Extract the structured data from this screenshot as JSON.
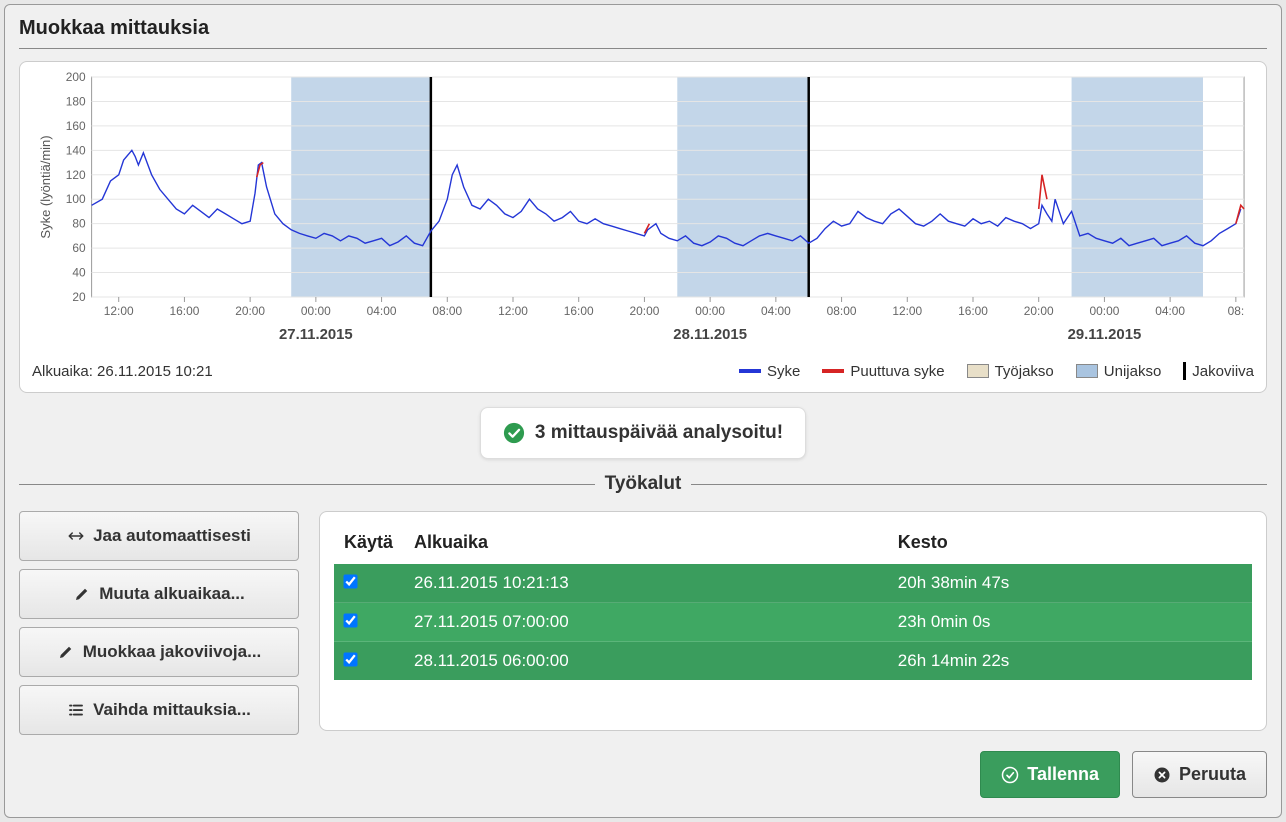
{
  "dialog_title": "Muokkaa mittauksia",
  "status_message": "3 mittauspäivää analysoitu!",
  "tools_heading": "Työkalut",
  "chart_start_label": "Alkuaika: 26.11.2015 10:21",
  "legend": {
    "syke": "Syke",
    "puuttuva": "Puuttuva syke",
    "tyojakso": "Työjakso",
    "unijakso": "Unijakso",
    "jakoviiva": "Jakoviiva"
  },
  "tool_buttons": {
    "auto_split": "Jaa automaattisesti",
    "change_start": "Muuta alkuaikaa...",
    "edit_dividers": "Muokkaa jakoviivoja...",
    "change_measurements": "Vaihda mittauksia..."
  },
  "table": {
    "headers": {
      "use": "Käytä",
      "start": "Alkuaika",
      "duration": "Kesto"
    },
    "rows": [
      {
        "checked": true,
        "start": "26.11.2015 10:21:13",
        "duration": "20h 38min 47s"
      },
      {
        "checked": true,
        "start": "27.11.2015 07:00:00",
        "duration": "23h 0min 0s"
      },
      {
        "checked": true,
        "start": "28.11.2015 06:00:00",
        "duration": "26h 14min 22s"
      }
    ]
  },
  "footer": {
    "save": "Tallenna",
    "cancel": "Peruuta"
  },
  "chart_data": {
    "type": "line",
    "title": "",
    "ylabel": "Syke (lyöntiä/min)",
    "xlabel": "",
    "ylim": [
      20,
      200
    ],
    "yticks": [
      20,
      40,
      60,
      80,
      100,
      120,
      140,
      160,
      180,
      200
    ],
    "x_start_hours": 10.35,
    "x_end_hours": 80.5,
    "xticks_hours": [
      12,
      16,
      20,
      24,
      28,
      32,
      36,
      40,
      44,
      48,
      52,
      56,
      60,
      64,
      68,
      72,
      76,
      80
    ],
    "xtick_labels": [
      "12:00",
      "16:00",
      "20:00",
      "00:00",
      "04:00",
      "08:00",
      "12:00",
      "16:00",
      "20:00",
      "00:00",
      "04:00",
      "08:00",
      "12:00",
      "16:00",
      "20:00",
      "00:00",
      "04:00",
      "08:"
    ],
    "date_labels": [
      {
        "hour": 24,
        "text": "27.11.2015"
      },
      {
        "hour": 48,
        "text": "28.11.2015"
      },
      {
        "hour": 72,
        "text": "29.11.2015"
      }
    ],
    "sleep_bands_hours": [
      {
        "start": 22.5,
        "end": 31
      },
      {
        "start": 46,
        "end": 54
      },
      {
        "start": 70,
        "end": 78
      }
    ],
    "divider_hours": [
      31,
      54
    ],
    "series": [
      {
        "name": "Syke",
        "color": "#2436d6",
        "x_hours": [
          10.35,
          11,
          11.5,
          12,
          12.3,
          12.8,
          13,
          13.2,
          13.5,
          14,
          14.5,
          15,
          15.5,
          16,
          16.5,
          17,
          17.5,
          18,
          18.5,
          19,
          19.5,
          20,
          20.3,
          20.5,
          20.7,
          21,
          21.5,
          22,
          22.5,
          23,
          23.5,
          24,
          24.5,
          25,
          25.5,
          26,
          26.5,
          27,
          27.5,
          28,
          28.5,
          29,
          29.5,
          30,
          30.5,
          31,
          31.5,
          32,
          32.3,
          32.6,
          33,
          33.5,
          34,
          34.5,
          35,
          35.5,
          36,
          36.5,
          37,
          37.5,
          38,
          38.5,
          39,
          39.5,
          40,
          40.5,
          41,
          41.5,
          42,
          42.5,
          43,
          44,
          44.2,
          44.7,
          45,
          45.5,
          46,
          46.5,
          47,
          47.5,
          48,
          48.5,
          49,
          49.5,
          50,
          50.5,
          51,
          51.5,
          52,
          52.5,
          53,
          53.5,
          54,
          54.5,
          55,
          55.5,
          56,
          56.5,
          57,
          57.5,
          58,
          58.5,
          59,
          59.5,
          60,
          60.5,
          61,
          61.5,
          62,
          62.5,
          63,
          63.5,
          64,
          64.5,
          65,
          65.5,
          66,
          66.5,
          67,
          67.5,
          68,
          68.2,
          68.5,
          68.8,
          69,
          69.5,
          70,
          70.5,
          71,
          71.5,
          72,
          72.5,
          73,
          73.5,
          74,
          74.5,
          75,
          75.5,
          76,
          76.5,
          77,
          77.5,
          78,
          78.5,
          79,
          79.5,
          80,
          80.3
        ],
        "values": [
          95,
          100,
          115,
          120,
          132,
          140,
          135,
          128,
          138,
          120,
          108,
          100,
          92,
          88,
          95,
          90,
          85,
          92,
          88,
          84,
          80,
          82,
          105,
          128,
          130,
          110,
          88,
          80,
          75,
          72,
          70,
          68,
          72,
          70,
          66,
          70,
          68,
          64,
          66,
          68,
          62,
          65,
          70,
          64,
          62,
          74,
          82,
          100,
          120,
          128,
          110,
          95,
          92,
          100,
          95,
          88,
          85,
          90,
          100,
          92,
          88,
          82,
          85,
          90,
          82,
          80,
          84,
          80,
          78,
          76,
          74,
          70,
          75,
          80,
          72,
          68,
          66,
          70,
          64,
          62,
          65,
          70,
          68,
          64,
          62,
          66,
          70,
          72,
          70,
          68,
          66,
          70,
          64,
          68,
          76,
          82,
          78,
          80,
          90,
          85,
          82,
          80,
          88,
          92,
          86,
          80,
          78,
          82,
          88,
          82,
          80,
          78,
          84,
          80,
          82,
          78,
          85,
          82,
          80,
          76,
          80,
          95,
          88,
          82,
          100,
          80,
          90,
          70,
          72,
          68,
          66,
          64,
          68,
          62,
          64,
          66,
          68,
          62,
          64,
          66,
          70,
          64,
          62,
          66,
          72,
          76,
          80,
          92
        ]
      },
      {
        "name": "Puuttuva syke",
        "color": "#d62424",
        "segments": [
          {
            "x_hours": [
              20.4,
              20.6,
              20.8
            ],
            "values": [
              118,
              128,
              130
            ]
          },
          {
            "x_hours": [
              44.0,
              44.3
            ],
            "values": [
              72,
              80
            ]
          },
          {
            "x_hours": [
              68.0,
              68.2,
              68.5
            ],
            "values": [
              92,
              120,
              100
            ]
          },
          {
            "x_hours": [
              80.0,
              80.3,
              80.5
            ],
            "values": [
              80,
              95,
              92
            ]
          }
        ]
      }
    ]
  }
}
